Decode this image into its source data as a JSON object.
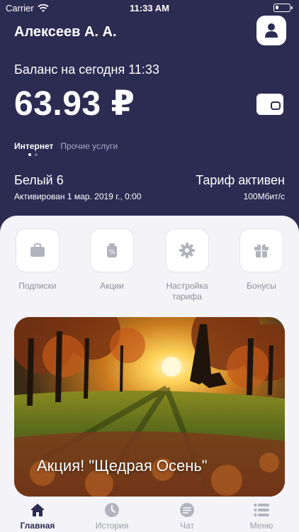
{
  "status_bar": {
    "carrier": "Carrier",
    "time": "11:33 AM"
  },
  "header": {
    "user_name": "Алексеев А. А."
  },
  "balance": {
    "label": "Баланс на сегодня 11:33",
    "amount": "63.93 ₽"
  },
  "tabs": [
    {
      "label": "Интернет"
    },
    {
      "label": "Прочие услуги"
    }
  ],
  "tariff": {
    "name": "Белый 6",
    "status": "Тариф активен",
    "activated": "Активирован 1 мар. 2019 г., 0:00",
    "speed": "100Мбит/с"
  },
  "actions": [
    {
      "label": "Подписки",
      "icon": "briefcase-icon"
    },
    {
      "label": "Акции",
      "icon": "discount-tag-icon"
    },
    {
      "label": "Настройка тарифа",
      "icon": "gear-icon"
    },
    {
      "label": "Бонусы",
      "icon": "gift-icon"
    }
  ],
  "promo": {
    "title": "Акция! \"Щедрая Осень\""
  },
  "tab_bar": [
    {
      "label": "Главная",
      "icon": "home-icon",
      "active": true
    },
    {
      "label": "История",
      "icon": "clock-icon"
    },
    {
      "label": "Чат",
      "icon": "chat-icon"
    },
    {
      "label": "Меню",
      "icon": "menu-list-icon"
    }
  ],
  "colors": {
    "header_bg": "#2c2b52",
    "sheet_bg": "#f3f3f8",
    "icon_gray": "#b3b3be",
    "active": "#2c2b52"
  }
}
